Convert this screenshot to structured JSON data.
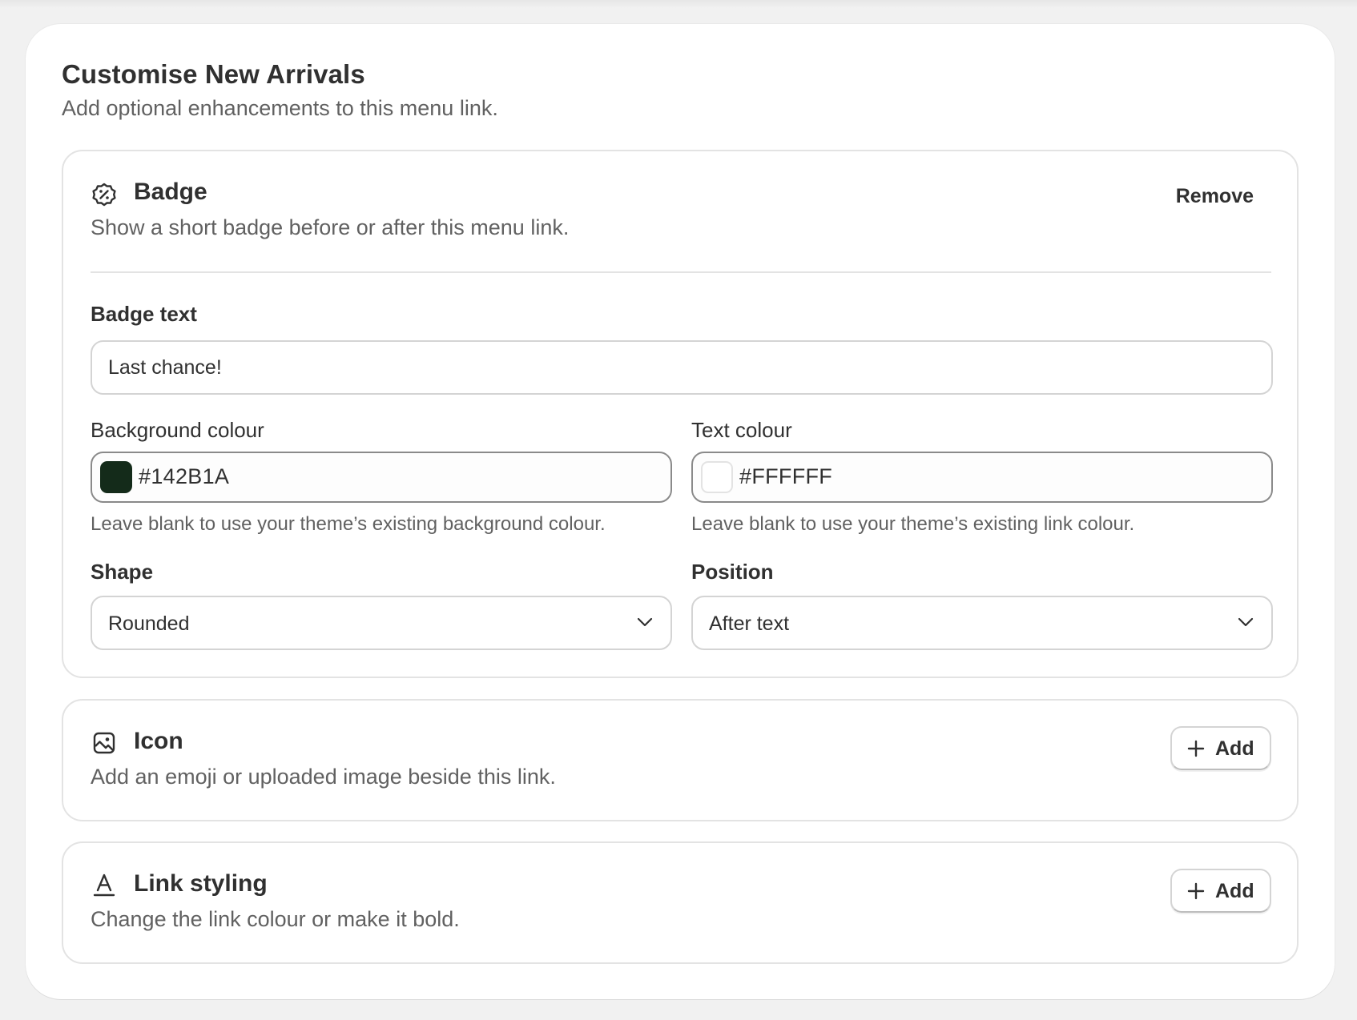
{
  "panel": {
    "title": "Customise New Arrivals",
    "subtitle": "Add optional enhancements to this menu link."
  },
  "badge_section": {
    "icon": "badge-icon",
    "title": "Badge",
    "description": "Show a short badge before or after this menu link.",
    "remove_label": "Remove",
    "badge_text": {
      "label": "Badge text",
      "value": "Last chance!"
    },
    "background_colour": {
      "label": "Background colour",
      "value": "#142B1A",
      "swatch": "#142B1A",
      "help": "Leave blank to use your theme’s existing background colour."
    },
    "text_colour": {
      "label": "Text colour",
      "value": "#FFFFFF",
      "swatch": "#FFFFFF",
      "help": "Leave blank to use your theme’s existing link colour."
    },
    "shape": {
      "label": "Shape",
      "value": "Rounded"
    },
    "position": {
      "label": "Position",
      "value": "After text"
    }
  },
  "icon_section": {
    "icon": "image-icon",
    "title": "Icon",
    "description": "Add an emoji or uploaded image beside this link.",
    "add_label": "Add"
  },
  "link_styling_section": {
    "icon": "text-style-icon",
    "title": "Link styling",
    "description": "Change the link colour or make it bold.",
    "add_label": "Add"
  },
  "colors": {
    "page_background": "#F1F1F1",
    "card_background": "#FFFFFF",
    "text_primary": "#303030",
    "text_secondary": "#616161",
    "border": "#E3E3E3"
  }
}
